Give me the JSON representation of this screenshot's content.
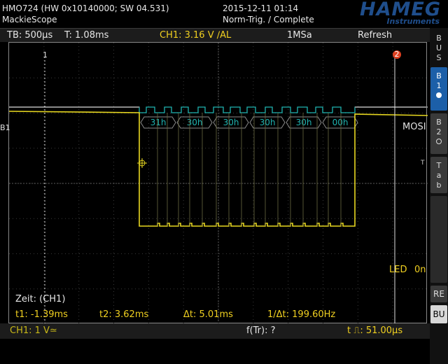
{
  "header": {
    "device": "HMO724 (HW 0x10140000; SW 04.531)",
    "name": "MackieScope",
    "datetime": "2015-12-11 01:14",
    "trigger_state": "Norm-Trig. / Complete",
    "brand": "HAMEG",
    "brand_sub": "Instruments"
  },
  "infobar": {
    "timebase": "TB: 500µs",
    "trigger_time": "T: 1.08ms",
    "trigger_channel": "CH1: 3.16 V ∕AL",
    "sample_rate": "1MSa",
    "refresh": "Refresh"
  },
  "waveform": {
    "bus_label": "B1",
    "bus_name": "MOSI",
    "decoded_bytes": [
      "31h",
      "30h",
      "30h",
      "30h",
      "30h",
      "00h"
    ],
    "cursor1_marker": "1",
    "cursor2_marker": "2",
    "trigger_marker": "T",
    "led_label": "LED",
    "led_state": "0n",
    "trace_color": "#e8d820",
    "bus_color": "#1fb3b0"
  },
  "measurements": {
    "title": "Zeit: (CH1)",
    "t1": "t1: -1.39ms",
    "t2": "t2: 3.62ms",
    "dt": "Δt: 5.01ms",
    "inv_dt": "1/Δt: 199.60Hz"
  },
  "bottom": {
    "ch1": "CH1: 1 V≃",
    "ftr": "f(Tr): ?",
    "pulse": "t ⎍: 51.00µs"
  },
  "side": {
    "bus": "BUS",
    "b1": "B1",
    "b2": "B2",
    "tab": "Tab",
    "ref": "RE",
    "bu": "BU"
  }
}
